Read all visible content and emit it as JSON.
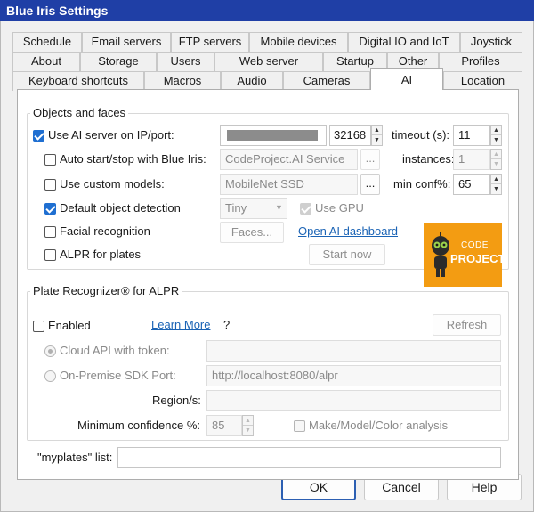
{
  "window": {
    "title": "Blue Iris Settings"
  },
  "tabs": {
    "row1": [
      "Schedule",
      "Email servers",
      "FTP servers",
      "Mobile devices",
      "Digital IO and IoT",
      "Joystick"
    ],
    "row2": [
      "About",
      "Storage",
      "Users",
      "Web server",
      "Startup",
      "Other",
      "Profiles"
    ],
    "row3": [
      "Keyboard shortcuts",
      "Macros",
      "Audio",
      "Cameras",
      "AI",
      "Location"
    ],
    "active": "AI"
  },
  "objects": {
    "title": "Objects and faces",
    "use_ai_label": "Use AI server on IP/port:",
    "use_ai_checked": true,
    "port": "32168",
    "timeout_label": "timeout (s):",
    "timeout": "11",
    "autostart_label": "Auto start/stop with Blue Iris:",
    "autostart_checked": false,
    "service_value": "CodeProject.AI Service",
    "browse1": "...",
    "instances_label": "instances:",
    "instances": "1",
    "custom_models_label": "Use custom models:",
    "custom_models_checked": false,
    "model_value": "MobileNet SSD",
    "browse2": "...",
    "minconf_label": "min conf%:",
    "minconf": "65",
    "default_detection_label": "Default object detection",
    "default_detection_checked": true,
    "size_value": "Tiny",
    "gpu_label": "Use GPU",
    "gpu_checked": true,
    "facial_label": "Facial recognition",
    "facial_checked": false,
    "faces_button": "Faces...",
    "dashboard_link": "Open AI dashboard",
    "alpr_label": "ALPR for plates",
    "alpr_checked": false,
    "start_button": "Start now",
    "logo_code": "CODE",
    "logo_project": "PROJECT"
  },
  "plate": {
    "title": "Plate Recognizer® for ALPR",
    "enabled_label": "Enabled",
    "enabled_checked": false,
    "learn_more": "Learn More",
    "help_mark": "?",
    "refresh_button": "Refresh",
    "cloud_label": "Cloud API with token:",
    "cloud_selected": true,
    "onprem_label": "On-Premise SDK Port:",
    "onprem_value": "http://localhost:8080/alpr",
    "region_label": "Region/s:",
    "region_value": "",
    "minconf_label": "Minimum confidence %:",
    "minconf": "85",
    "mmc_label": "Make/Model/Color analysis",
    "mmc_checked": false
  },
  "myplates": {
    "label": "\"myplates\" list:",
    "value": ""
  },
  "buttons": {
    "ok": "OK",
    "cancel": "Cancel",
    "help": "Help"
  },
  "colors": {
    "titlebar": "#1f3fa6",
    "checkbox": "#1f6fd1",
    "link": "#1a63b5",
    "logo": "#f39c12"
  }
}
